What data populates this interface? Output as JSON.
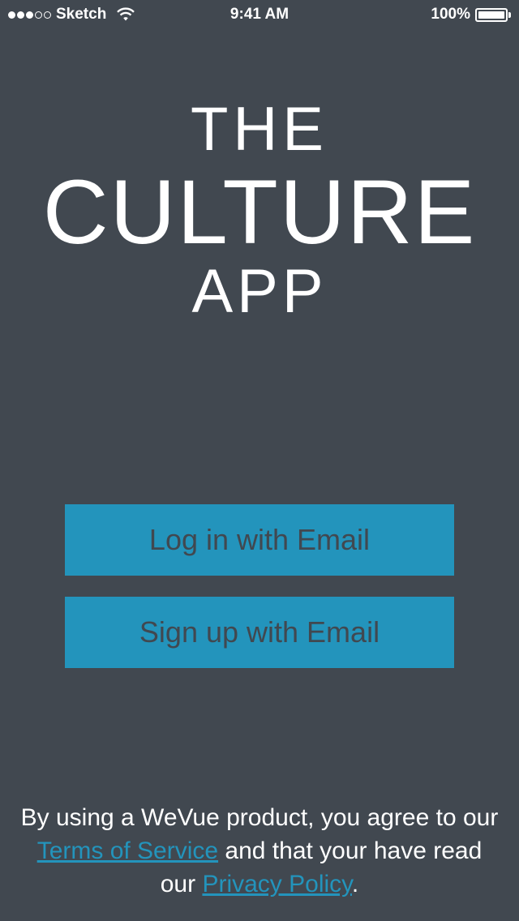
{
  "status_bar": {
    "carrier": "Sketch",
    "signal_bars": 5,
    "signal_filled": 3,
    "time": "9:41 AM",
    "battery_percent": "100%",
    "wifi_icon": "wifi-icon",
    "battery_icon": "battery-icon"
  },
  "logo": {
    "line1": "THE",
    "line2": "CULTURE",
    "line3": "APP"
  },
  "buttons": {
    "login_label": "Log in with Email",
    "signup_label": "Sign up with Email"
  },
  "footer": {
    "text_before": "By using a WeVue product, you agree to our ",
    "terms_link": "Terms of Service",
    "text_middle": " and that your have read our ",
    "privacy_link": "Privacy Policy",
    "text_end": "."
  },
  "colors": {
    "background": "#414850",
    "accent": "#2394bc",
    "text": "#ffffff"
  }
}
